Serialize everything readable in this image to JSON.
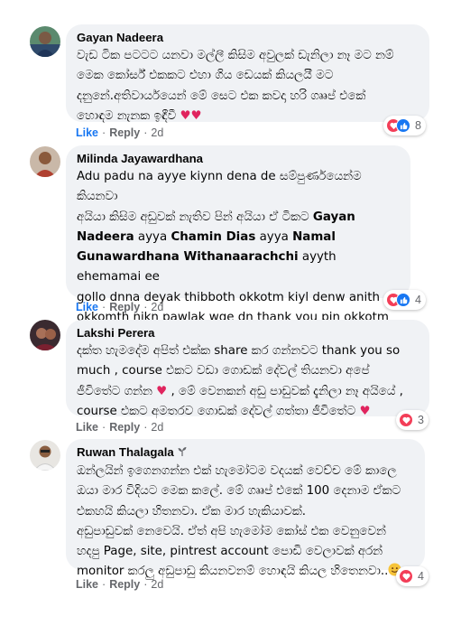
{
  "comments": [
    {
      "author": "Gayan Nadeera",
      "lines": [
        "වැඩ ටික පටටට යනවා මල්ලී කිසිම අවුලක් ඩැනිලා නෑ මට නම්",
        "මෙක කෝර්ස් එකකට එහා ගිය ඩෙයක් කියලයී මට",
        "දනුනේ.අතිවාර්යයෙන් මේ සෙට එක කවදා හරි ගෲප් එකේ",
        "හොඳම නැනක ඉඳීවී"
      ],
      "reaction_count": "8",
      "like_label": "Like",
      "reply_label": "Reply",
      "time": "2d"
    },
    {
      "author": "Milinda Jayawardhana",
      "lines": [
        "Adu padu na ayye kiynn dena de සම්පුර්ණයෙන්ම කියනවා",
        "අයියා කිසිම අඩුවක් නැතිව පින් අයියා ඒ ටිකට",
        "ayya",
        "ayya",
        "ayyth ehemamai ee",
        "gollo dnna deyak thibboth okkotm kiyl denw anith",
        "okkomth nikn pawlak wge dn thank you pin okkotm"
      ],
      "mentions": [
        "Gayan",
        "Nadeera",
        "Chamin Dias",
        "Namal",
        "Gunawardhana Withanaarachchi"
      ],
      "reaction_count": "4",
      "like_label": "Like",
      "reply_label": "Reply",
      "time": "2d"
    },
    {
      "author": "Lakshi Perera",
      "lines": [
        "දක්ත හැමදේම අපිත් එක්ක share කර ගන්නවට thank you so",
        "much , course එකට වඩා ගොඩක් දේවල් තියනවා අපේ",
        "ජීවිතේට ගන්න",
        ", මේ වෙනකන් අඩු පාඩුවක් දැනිලා නෑ අයියේ ,",
        "course එකට අමතරව ගොඩක් දේවල් ගත්තා ජීවිතේට"
      ],
      "reaction_count": "3",
      "like_label": "Like",
      "reply_label": "Reply",
      "time": "2d"
    },
    {
      "author": "Ruwan Thalagala",
      "lines": [
        "ඔන්ලයින් ඉගෙනගන්න එක් හැමෝටම වදයක් වෙච්ච මේ කාලෙ",
        "ඔයා මාර විදියට මෙක කලේ. මේ ගෲප් එකේ 100 දෙනාම ඒකට",
        "එකහයි කියලා හිතනවා. ඒක මාර හැකියාවක්.",
        "අඩුපාඩුවක් නෙවෙයි. ඒත් අපි හැමෝම කෝස් එක වෙනුවෙන්",
        "හදපු Page, site, pintrest account පොඩි වෙලාවක් අරන්",
        "monitor කරලු අඩුපාඩු කියනවනම් හොඳයි කියල හිතෙනවා.."
      ],
      "reaction_count": "4",
      "like_label": "Like",
      "reply_label": "Reply",
      "time": "2d"
    }
  ]
}
